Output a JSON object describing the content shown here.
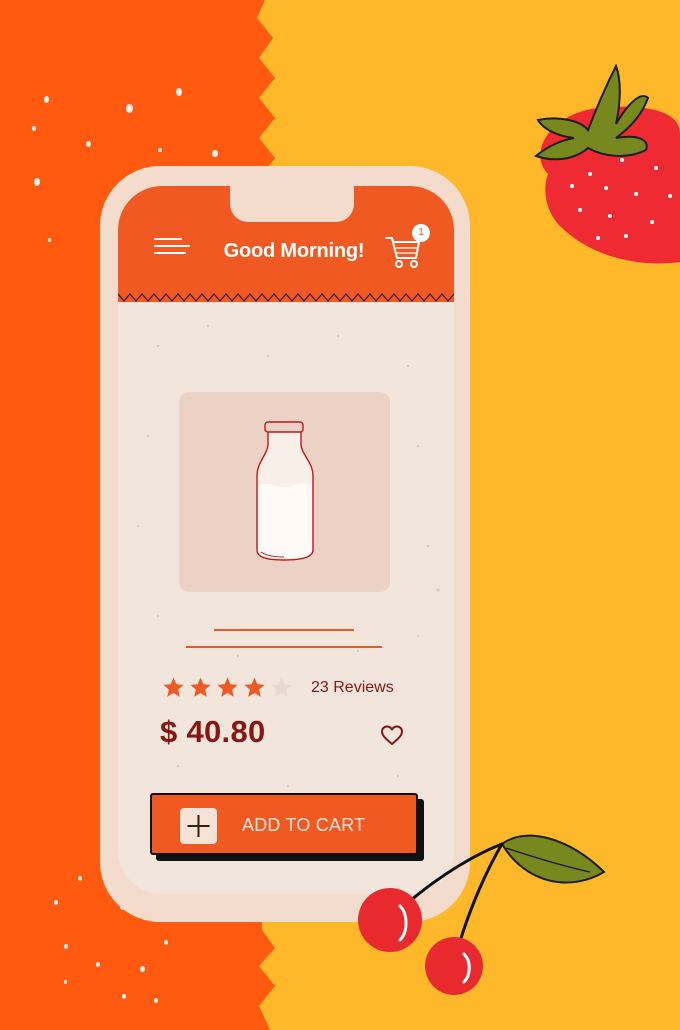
{
  "header": {
    "greeting": "Good Morning!",
    "cart_count": "1"
  },
  "product": {
    "rating": 4,
    "rating_max": 5,
    "reviews_label": "23 Reviews",
    "price": "$ 40.80",
    "add_to_cart_label": "ADD TO CART"
  },
  "icons": {
    "menu": "hamburger-menu-icon",
    "cart": "shopping-cart-icon",
    "product": "milk-bottle-icon",
    "favorite": "heart-icon",
    "add": "plus-icon",
    "decor": [
      "strawberry",
      "cherries"
    ]
  },
  "colors": {
    "left_background": "#ff5a10",
    "right_background": "#ffb82a",
    "accent": "#f05a22",
    "price_text": "#8a1410",
    "star_active": "#f05a22",
    "star_inactive": "#e9d7cf",
    "screen": "#f2e6dc"
  }
}
